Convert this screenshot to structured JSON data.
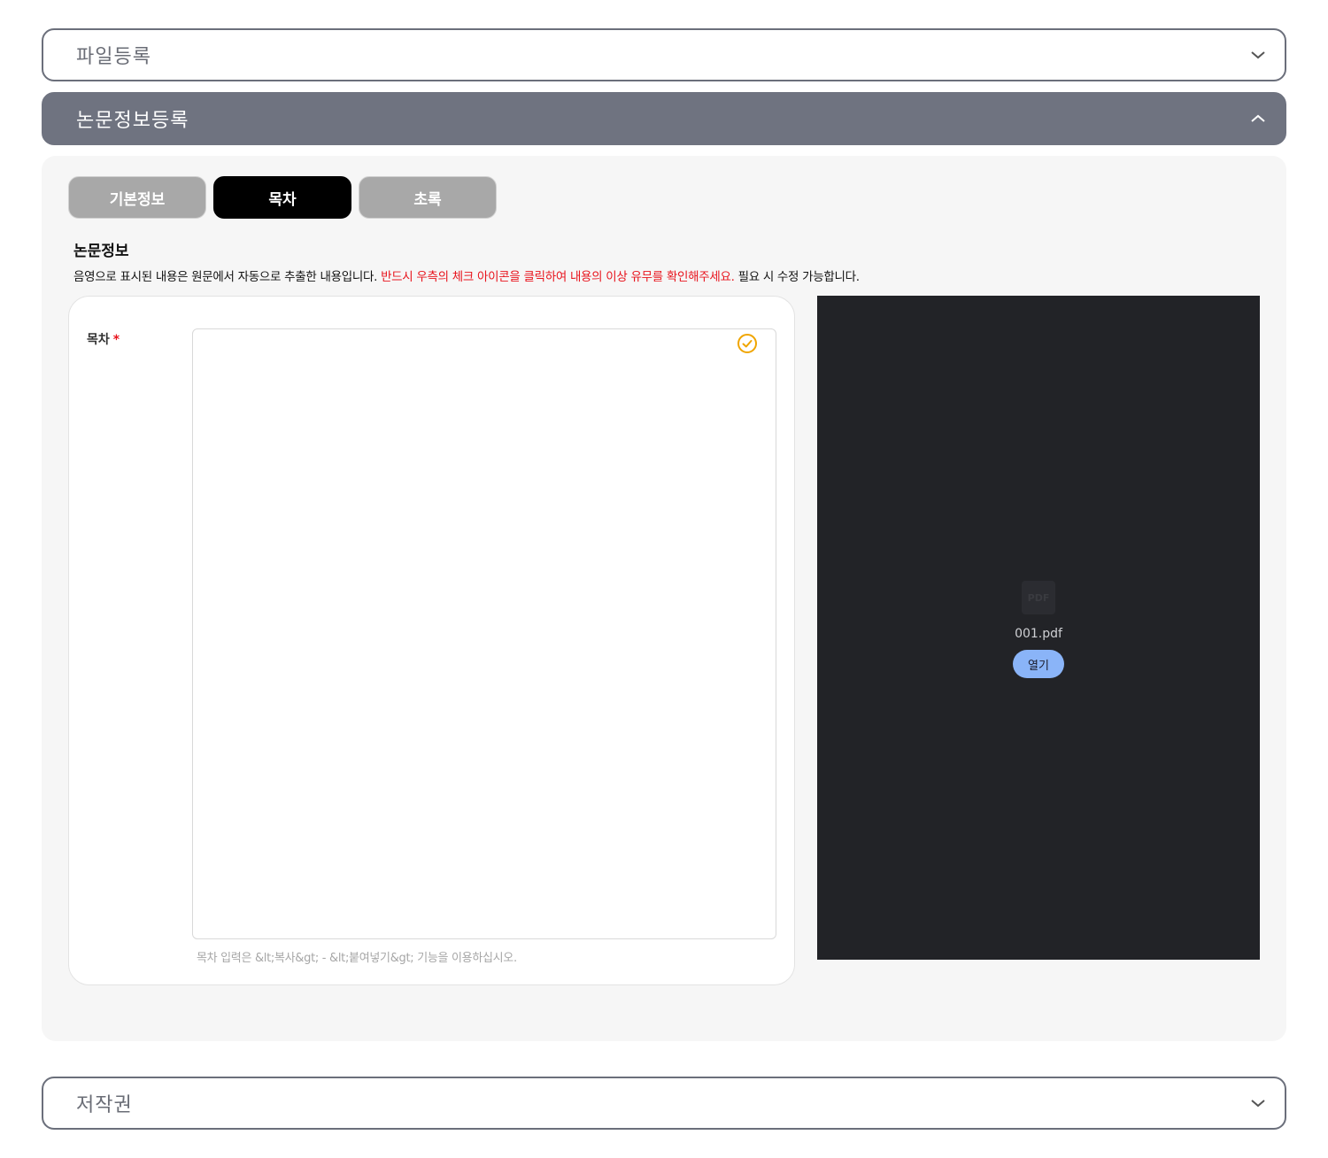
{
  "accordions": {
    "file_register": {
      "title": "파일등록",
      "icon": "chevron-down-icon"
    },
    "paper_info_register": {
      "title": "논문정보등록",
      "icon": "chevron-up-icon"
    },
    "copyright": {
      "title": "저작권",
      "icon": "chevron-down-icon"
    }
  },
  "tabs": [
    {
      "label": "기본정보",
      "active": false
    },
    {
      "label": "목차",
      "active": true
    },
    {
      "label": "초록",
      "active": false
    }
  ],
  "section": {
    "title": "논문정보",
    "notice_plain_1": "음영으로 표시된 내용은 원문에서 자동으로 추출한 내용입니다. ",
    "notice_warning": "반드시 우측의 체크 아이콘을 클릭하여 내용의 이상 유무를 확인해주세요.",
    "notice_plain_2": " 필요 시 수정 가능합니다."
  },
  "form": {
    "toc_label": "목차",
    "required_mark": "*",
    "toc_value": "",
    "hint": "목차 입력은 &lt;복사&gt; - &lt;붙여넣기&gt; 기능을 이용하십시오."
  },
  "viewer": {
    "file_icon_text": "PDF",
    "file_name": "001.pdf",
    "open_label": "열기"
  },
  "colors": {
    "active_tab": "#000000",
    "inactive_tab": "#a8a8a8",
    "warning_text": "#e8141d",
    "check_icon": "#f0a500",
    "open_button": "#8ab4f8",
    "viewer_bg": "#222327"
  }
}
